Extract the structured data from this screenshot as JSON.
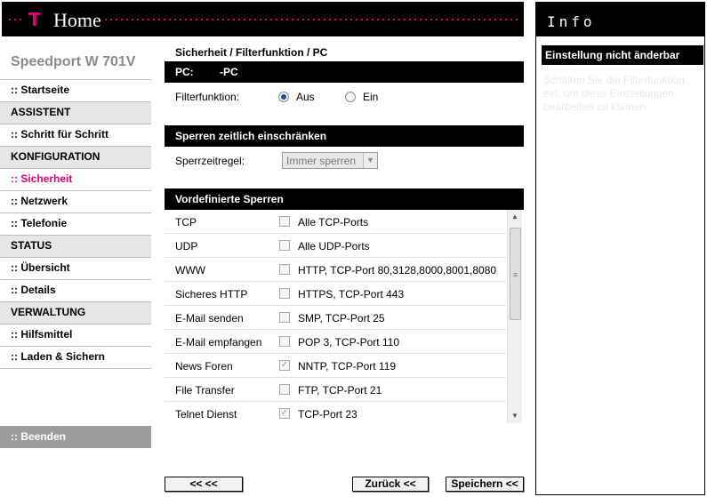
{
  "header": {
    "logo_t": "T",
    "home_label": "Home",
    "brand_color": "#e20074"
  },
  "sidebar": {
    "product_name": "Speedport W 701V",
    "items": [
      {
        "label": ":: Startseite",
        "type": "link"
      },
      {
        "label": "ASSISTENT",
        "type": "section"
      },
      {
        "label": ":: Schritt für Schritt",
        "type": "link"
      },
      {
        "label": "KONFIGURATION",
        "type": "section"
      },
      {
        "label": ":: Sicherheit",
        "type": "link",
        "active": true
      },
      {
        "label": ":: Netzwerk",
        "type": "link"
      },
      {
        "label": ":: Telefonie",
        "type": "link"
      },
      {
        "label": "STATUS",
        "type": "section"
      },
      {
        "label": ":: Übersicht",
        "type": "link"
      },
      {
        "label": ":: Details",
        "type": "link"
      },
      {
        "label": "VERWALTUNG",
        "type": "section"
      },
      {
        "label": ":: Hilfsmittel",
        "type": "link"
      },
      {
        "label": ":: Laden & Sichern",
        "type": "link"
      }
    ],
    "logout_label": ":: Beenden"
  },
  "main": {
    "breadcrumb": "Sicherheit / Filterfunktion / PC",
    "pc_bar_label": "PC:",
    "pc_name": "-PC",
    "filter_label": "Filterfunktion:",
    "filter_options": [
      {
        "label": "Aus",
        "selected": true
      },
      {
        "label": "Ein",
        "selected": false
      }
    ],
    "time_section_title": "Sperren zeitlich einschränken",
    "time_rule_label": "Sperrzeitregel:",
    "time_rule_value": "Immer sperren",
    "blocks_title": "Vordefinierte Sperren",
    "blocks": [
      {
        "label": "TCP",
        "desc": "Alle TCP-Ports",
        "checked": false
      },
      {
        "label": "UDP",
        "desc": "Alle UDP-Ports",
        "checked": false
      },
      {
        "label": "WWW",
        "desc": "HTTP, TCP-Port 80,3128,8000,8001,8080",
        "checked": false
      },
      {
        "label": "Sicheres HTTP",
        "desc": "HTTPS, TCP-Port 443",
        "checked": false
      },
      {
        "label": "E-Mail senden",
        "desc": "SMP, TCP-Port 25",
        "checked": false
      },
      {
        "label": "E-Mail empfangen",
        "desc": "POP 3, TCP-Port 110",
        "checked": false
      },
      {
        "label": "News Foren",
        "desc": "NNTP, TCP-Port 119",
        "checked": true
      },
      {
        "label": "File Transfer",
        "desc": "FTP, TCP-Port 21",
        "checked": false
      },
      {
        "label": "Telnet Dienst",
        "desc": "TCP-Port 23",
        "checked": true
      }
    ]
  },
  "buttons": {
    "back_back": "<<  <<",
    "zurueck": "Zurück <<",
    "speichern": "Speichern <<"
  },
  "info": {
    "title": "Info",
    "heading": "Einstellung nicht änderbar",
    "text": "Schalten Sie die Filterfunktion ein, um diese Einstellungen bearbeiten zu können"
  }
}
